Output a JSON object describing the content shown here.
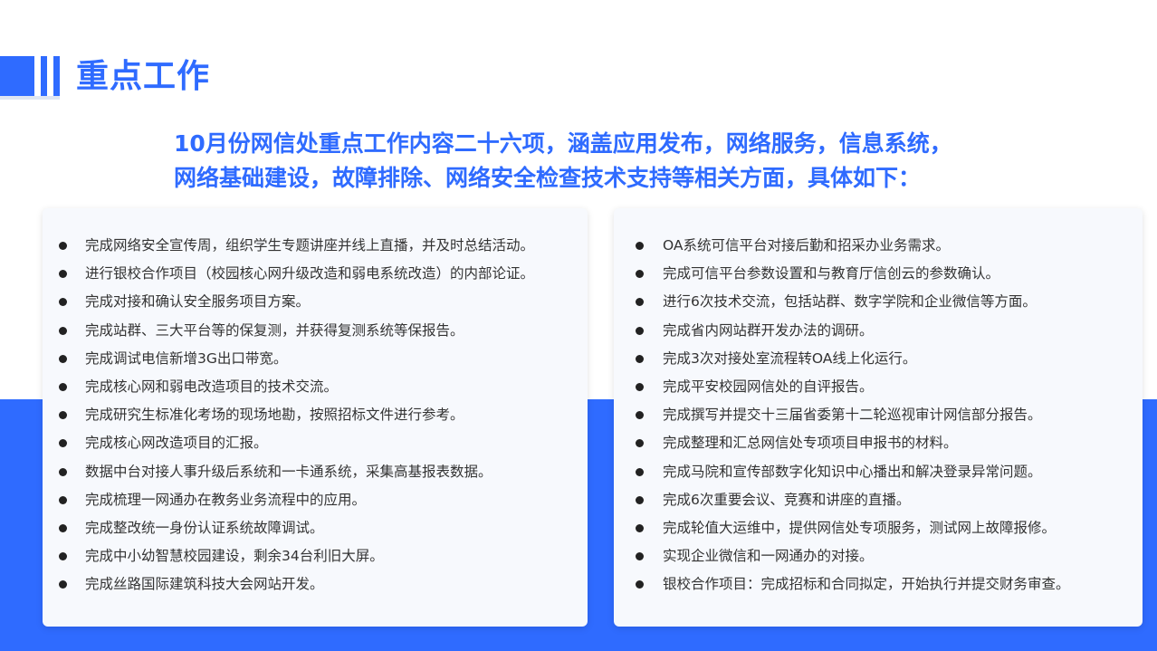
{
  "title": "重点工作",
  "intro": {
    "line1": "10月份网信处重点工作内容二十六项，涵盖应用发布，网络服务，信息系统，",
    "line2": "网络基础建设，故障排除、网络安全检查技术支持等相关方面，具体如下："
  },
  "left_items": [
    "完成网络安全宣传周，组织学生专题讲座并线上直播，并及时总结活动。",
    "进行银校合作项目（校园核心网升级改造和弱电系统改造）的内部论证。",
    "完成对接和确认安全服务项目方案。",
    "完成站群、三大平台等的保复测，并获得复测系统等保报告。",
    "完成调试电信新增3G出口带宽。",
    "完成核心网和弱电改造项目的技术交流。",
    "完成研究生标准化考场的现场地勘，按照招标文件进行参考。",
    "完成核心网改造项目的汇报。",
    "数据中台对接人事升级后系统和一卡通系统，采集高基报表数据。",
    "完成梳理一网通办在教务业务流程中的应用。",
    "完成整改统一身份认证系统故障调试。",
    "完成中小幼智慧校园建设，剩余34台利旧大屏。",
    "完成丝路国际建筑科技大会网站开发。"
  ],
  "right_items": [
    "OA系统可信平台对接后勤和招采办业务需求。",
    "完成可信平台参数设置和与教育厅信创云的参数确认。",
    "进行6次技术交流，包括站群、数字学院和企业微信等方面。",
    "完成省内网站群开发办法的调研。",
    "完成3次对接处室流程转OA线上化运行。",
    "完成平安校园网信处的自评报告。",
    "完成撰写并提交十三届省委第十二轮巡视审计网信部分报告。",
    "完成整理和汇总网信处专项项目申报书的材料。",
    "完成马院和宣传部数字化知识中心播出和解决登录异常问题。",
    "完成6次重要会议、竞赛和讲座的直播。",
    "完成轮值大运维中，提供网信处专项服务，测试网上故障报修。",
    "实现企业微信和一网通办的对接。",
    "银校合作项目：完成招标和合同拟定，开始执行并提交财务审查。"
  ],
  "colors": {
    "accent": "#2f6bff",
    "card_bg": "#f7f9fd",
    "text": "#333333"
  }
}
